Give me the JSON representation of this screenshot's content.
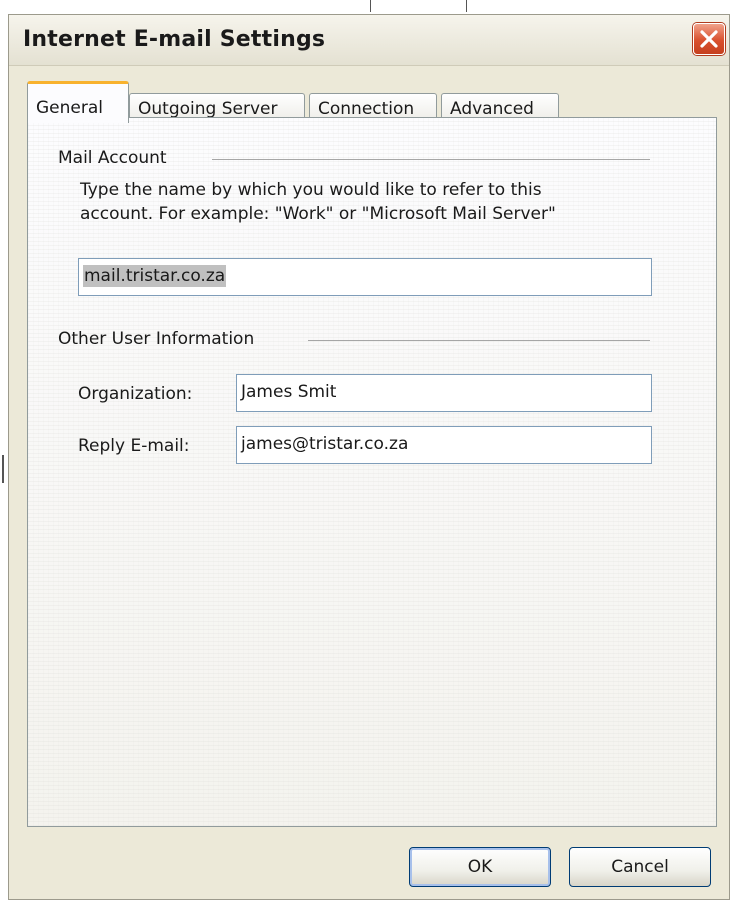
{
  "window": {
    "title": "Internet E-mail Settings"
  },
  "tabs": [
    {
      "label": "General",
      "active": true
    },
    {
      "label": "Outgoing Server",
      "active": false
    },
    {
      "label": "Connection",
      "active": false
    },
    {
      "label": "Advanced",
      "active": false
    }
  ],
  "mail_account": {
    "group_label": "Mail Account",
    "description_line1": "Type the name by which you would like to refer to this",
    "description_line2": "account.  For example: \"Work\" or \"Microsoft Mail Server\"",
    "account_name_value": "mail.tristar.co.za"
  },
  "other_user_info": {
    "group_label": "Other User Information",
    "organization_label": "Organization:",
    "organization_value": "James Smit",
    "reply_email_label": "Reply E-mail:",
    "reply_email_value": "james@tristar.co.za"
  },
  "buttons": {
    "ok_label": "OK",
    "cancel_label": "Cancel"
  },
  "icons": {
    "close": "close-icon"
  },
  "colors": {
    "dialog_bg": "#ece9d8",
    "active_tab_accent": "#f8b22e",
    "close_button": "#d9502e",
    "input_border": "#7f9db9",
    "button_border": "#003c74"
  }
}
